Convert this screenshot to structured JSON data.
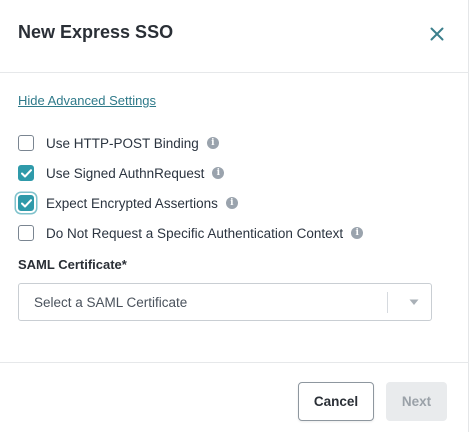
{
  "dialog": {
    "title": "New Express SSO"
  },
  "advanced": {
    "link_label": "Hide Advanced Settings"
  },
  "options": [
    {
      "label": "Use HTTP-POST Binding",
      "checked": false
    },
    {
      "label": "Use Signed AuthnRequest",
      "checked": true
    },
    {
      "label": "Expect Encrypted Assertions",
      "checked": true
    },
    {
      "label": "Do Not Request a Specific Authentication Context",
      "checked": false
    }
  ],
  "info_glyph": "i",
  "certificate": {
    "label": "SAML Certificate*",
    "placeholder": "Select a SAML Certificate"
  },
  "footer": {
    "cancel_label": "Cancel",
    "next_label": "Next"
  },
  "colors": {
    "accent": "#2f9aaa",
    "link": "#2f7a8a",
    "disabled_bg": "#e9ebed",
    "disabled_text": "#9aa1a8"
  },
  "icons": {
    "close": "close-icon",
    "checkmark": "checkmark-icon",
    "info": "info-icon",
    "dropdown": "chevron-down-icon"
  }
}
